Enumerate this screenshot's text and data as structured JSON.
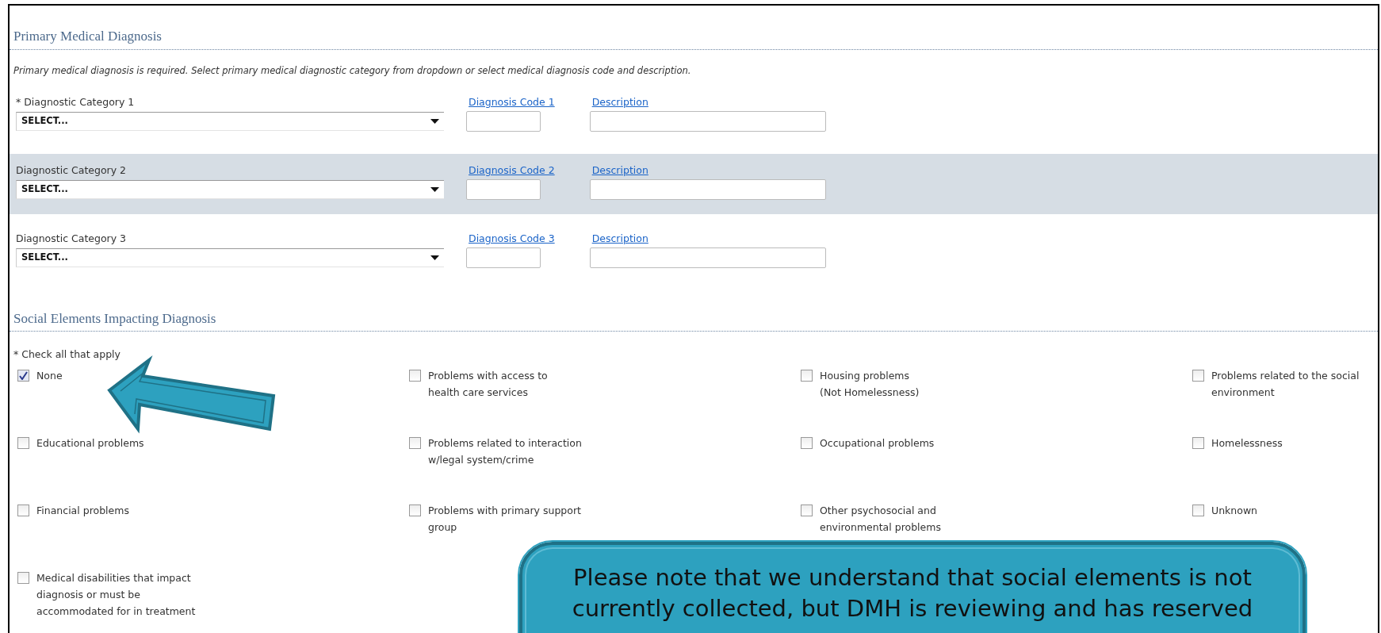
{
  "sections": [
    {
      "title": "Primary Medical Diagnosis"
    },
    {
      "title": "Social Elements Impacting Diagnosis"
    }
  ],
  "note": "Primary medical diagnosis is required. Select primary medical diagnostic category from dropdown or select medical diagnosis code and description.",
  "diagnosis_rows": [
    {
      "label": "* Diagnostic Category 1",
      "value": "SELECT...",
      "code_link": "Diagnosis Code 1",
      "description_link": "Description",
      "shaded": false
    },
    {
      "label": "Diagnostic Category 2",
      "value": "SELECT...",
      "code_link": "Diagnosis Code 2",
      "description_link": "Description",
      "shaded": true
    },
    {
      "label": "Diagnostic Category 3",
      "value": "SELECT...",
      "code_link": "Diagnosis Code 3",
      "description_link": "Description",
      "shaded": false
    }
  ],
  "check_hint": "* Check all that apply",
  "social_elements": [
    {
      "lines": [
        "None"
      ],
      "checked": true
    },
    {
      "lines": [
        "Problems with access to",
        "health care services"
      ],
      "checked": false
    },
    {
      "lines": [
        "Housing problems",
        "(Not Homelessness)"
      ],
      "checked": false
    },
    {
      "lines": [
        "Problems related to the social",
        "environment"
      ],
      "checked": false
    },
    {
      "lines": [
        "Educational problems"
      ],
      "checked": false
    },
    {
      "lines": [
        "Problems related to interaction",
        "w/legal system/crime"
      ],
      "checked": false
    },
    {
      "lines": [
        "Occupational problems"
      ],
      "checked": false
    },
    {
      "lines": [
        "Homelessness"
      ],
      "checked": false
    },
    {
      "lines": [
        "Financial problems"
      ],
      "checked": false
    },
    {
      "lines": [
        "Problems with primary support",
        "group"
      ],
      "checked": false
    },
    {
      "lines": [
        "Other psychosocial and",
        "environmental problems"
      ],
      "checked": false
    },
    {
      "lines": [
        "Unknown"
      ],
      "checked": false
    },
    {
      "lines": [
        "Medical disabilities that impact",
        "diagnosis or must be",
        "accommodated for in treatment"
      ],
      "checked": false
    }
  ],
  "callout": {
    "lines": [
      "Please note that we understand that social elements is not",
      "currently collected, but DMH is reviewing and has reserved"
    ]
  }
}
